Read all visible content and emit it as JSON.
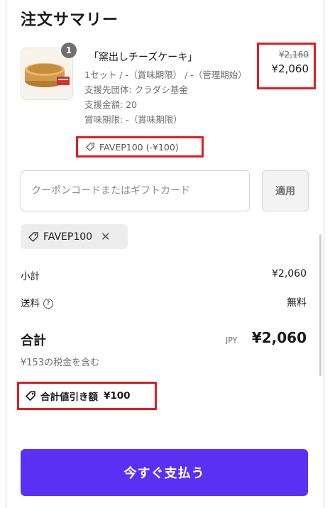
{
  "summary": {
    "title": "注文サマリー"
  },
  "product": {
    "quantity": "1",
    "name": "「窯出しチーズケーキ」",
    "variant": "1セット / -（賞味期限） / -（管理期始）",
    "support_group": "支援先団体: クラダシ基金",
    "support_amount": "支援金額: 20",
    "expiry": "賞味期限: -（賞味期限）",
    "discount_code": "FAVEP100 (-¥100)",
    "original_price": "¥2,160",
    "price": "¥2,060"
  },
  "coupon": {
    "placeholder": "クーポンコードまたはギフトカード",
    "apply_label": "適用",
    "applied_code": "FAVEP100",
    "remove_symbol": "✕"
  },
  "totals": {
    "subtotal_label": "小計",
    "subtotal_value": "¥2,060",
    "shipping_label": "送料",
    "shipping_help": "?",
    "shipping_value": "無料",
    "total_label": "合計",
    "currency": "JPY",
    "total_value": "¥2,060",
    "tax_note": "¥153の税金を含む",
    "total_discount_label": "合計値引き額",
    "total_discount_value": "¥100"
  },
  "pay_button_label": "今すぐ支払う",
  "colors": {
    "accent": "#5a31f4",
    "highlight": "#e01e25"
  }
}
